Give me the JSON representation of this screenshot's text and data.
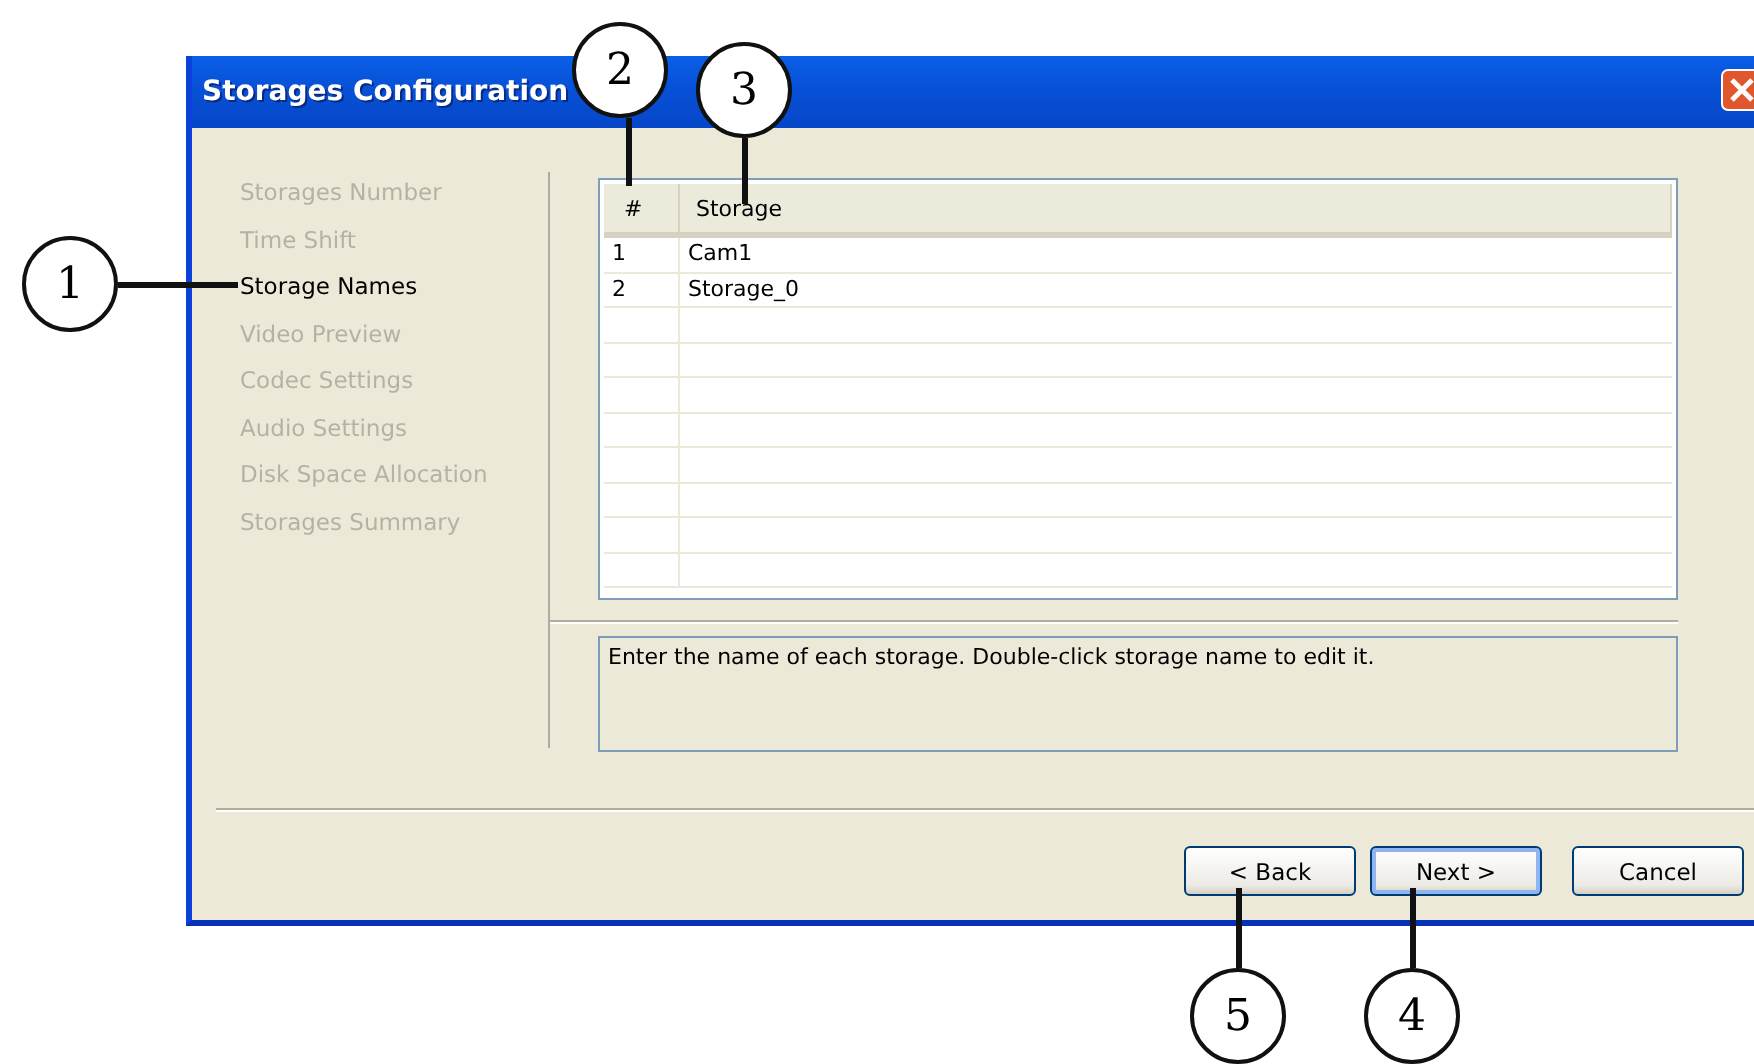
{
  "window": {
    "title": "Storages Configuration"
  },
  "steps": [
    {
      "label": "Storages Number",
      "selected": false
    },
    {
      "label": "Time Shift",
      "selected": false
    },
    {
      "label": "Storage Names",
      "selected": true
    },
    {
      "label": "Video Preview",
      "selected": false
    },
    {
      "label": "Codec Settings",
      "selected": false
    },
    {
      "label": "Audio Settings",
      "selected": false
    },
    {
      "label": "Disk Space Allocation",
      "selected": false
    },
    {
      "label": "Storages Summary",
      "selected": false
    }
  ],
  "table": {
    "columns": [
      "#",
      "Storage"
    ],
    "rows": [
      [
        "1",
        "Cam1"
      ],
      [
        "2",
        "Storage_0"
      ]
    ]
  },
  "description": "Enter the name of each storage. Double-click storage name to edit it.",
  "buttons": [
    {
      "label": "< Back",
      "default": false
    },
    {
      "label": "Next >",
      "default": true
    },
    {
      "label": "Cancel",
      "default": false
    }
  ],
  "callouts": [
    "1",
    "2",
    "3",
    "4",
    "5"
  ]
}
